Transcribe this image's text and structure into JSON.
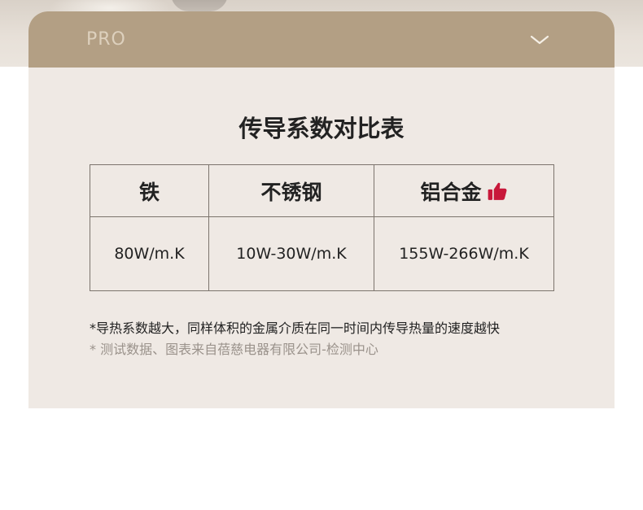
{
  "header": {
    "title": "PRO",
    "toggle_icon": "chevron-down-icon"
  },
  "section": {
    "title": "传导系数对比表",
    "table": {
      "columns": [
        "铁",
        "不锈钢",
        "铝合金"
      ],
      "values": [
        "80W/m.K",
        "10W-30W/m.K",
        "155W-266W/m.K"
      ],
      "highlight_icon": "thumbs-up-icon",
      "highlight_color": "#c8183a"
    },
    "notes": [
      "*导热系数越大，同样体积的金属介质在同一时间内传导热量的速度越快",
      "* 测试数据、图表来自蓓慈电器有限公司-检测中心"
    ]
  },
  "colors": {
    "card_bg": "#efe9e4",
    "header_bg": "#b39f84",
    "header_text": "#ddd0bd"
  }
}
